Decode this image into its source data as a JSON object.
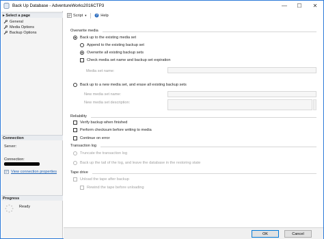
{
  "window": {
    "title": "Back Up Database - AdventureWorks2016CTP3",
    "controls": {
      "minimize": "—",
      "maximize": "☐",
      "close": "✕"
    }
  },
  "left": {
    "select_page": {
      "header": "Select a page",
      "items": [
        {
          "label": "General"
        },
        {
          "label": "Media Options"
        },
        {
          "label": "Backup Options"
        }
      ]
    },
    "connection": {
      "header": "Connection",
      "server_label": "Server:",
      "connection_label": "Connection:",
      "link": "View connection properties"
    },
    "progress": {
      "header": "Progress",
      "status": "Ready"
    }
  },
  "toolbar": {
    "script": "Script",
    "help": "Help"
  },
  "overwrite_media": {
    "title": "Overwrite media",
    "existing_set": "Back up to the existing media set",
    "append": "Append to the existing backup set",
    "overwrite_all": "Overwrite all existing backup sets",
    "check_name": "Check media set name and backup set expiration",
    "media_set_name_label": "Media set name:",
    "new_set": "Back up to a new media set, and erase all existing backup sets",
    "new_media_name_label": "New media set name:",
    "new_media_desc_label": "New media set description:"
  },
  "reliability": {
    "title": "Reliability",
    "verify": "Verify backup when finished",
    "checksum": "Perform checksum before writing to media",
    "continue": "Continue on error"
  },
  "transaction_log": {
    "title": "Transaction log",
    "truncate": "Truncate the transaction log",
    "tail": "Back up the tail of the log, and leave the database in the restoring state"
  },
  "tape_drive": {
    "title": "Tape drive",
    "unload": "Unload the tape after backup",
    "rewind": "Rewind the tape before unloading"
  },
  "buttons": {
    "ok": "OK",
    "cancel": "Cancel"
  },
  "colors": {
    "accent": "#0078d7",
    "link": "#1a5fb4",
    "pane_bg": "#f4f4f4"
  }
}
